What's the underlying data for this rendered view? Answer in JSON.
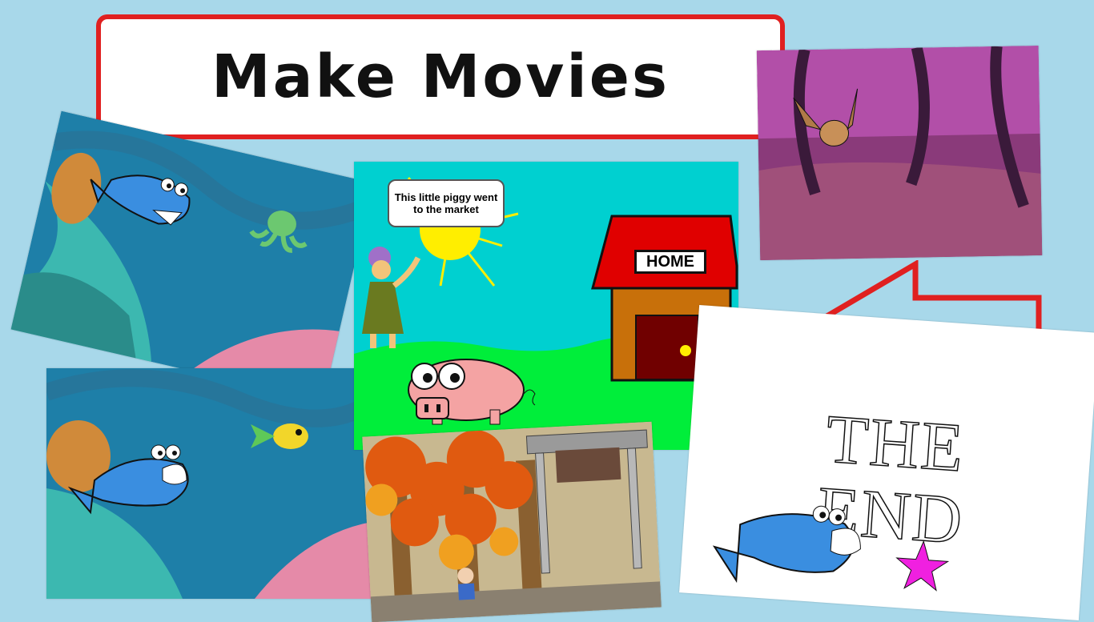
{
  "title": "Make Movies",
  "slides": {
    "ocean_top": {
      "name": "ocean-scene-top"
    },
    "ocean_bottom": {
      "name": "ocean-scene-bottom"
    },
    "piggy": {
      "speech": "This little piggy went to the market",
      "house_sign": "HOME"
    },
    "bat_forest": {
      "name": "bat-forest-scene"
    },
    "autumn_game": {
      "name": "autumn-forest-game-scene"
    },
    "the_end": {
      "line1": "THE",
      "line2": "END"
    }
  },
  "colors": {
    "background": "#a8d8ea",
    "title_border": "#e02020",
    "arrow": "#e02020"
  }
}
